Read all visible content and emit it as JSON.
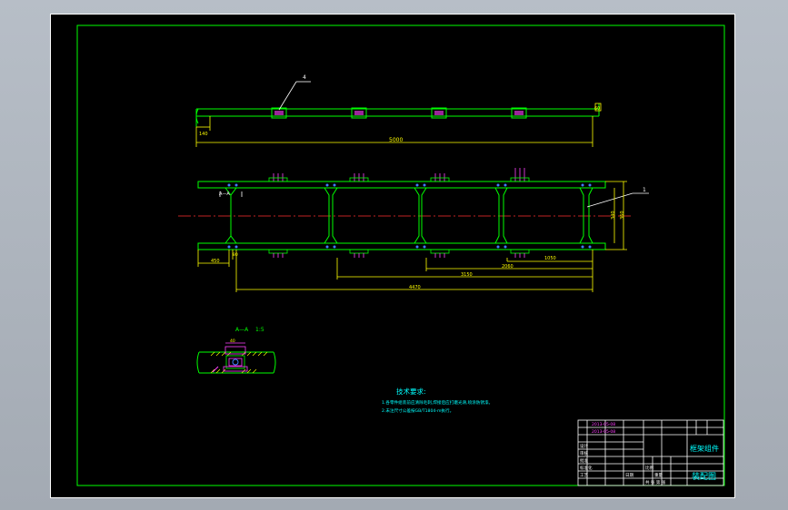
{
  "colors": {
    "frame": "#00ff00",
    "part": "#00ff00",
    "dim": "#ffff00",
    "center": "#ff3030",
    "bolt": "#ff40ff",
    "note": "#00ffff",
    "hatch": "#ffff00",
    "white": "#ffffff"
  },
  "top_view": {
    "balloon": "4",
    "dim_total": "5000",
    "dim_left": "140",
    "dim_right": "60"
  },
  "plan_view": {
    "balloon": "1",
    "section_marker": "A—A",
    "dim_right_inner": "340",
    "dim_right_outer": "360",
    "dim_left": "450",
    "dim_left_small": "80",
    "dim_a": "1050",
    "dim_b": "2060",
    "dim_c": "3150",
    "dim_total": "4470"
  },
  "section_view": {
    "title": "A—A",
    "scale": "1:5",
    "dim_top": "40"
  },
  "notes": {
    "heading": "技术要求:",
    "line1": "1.各零件组装前应清除毛刺,焊接后应打磨光滑,喷涂防锈漆。",
    "line2": "2.未注尺寸公差按GB/T1804-m执行。"
  },
  "title_block": {
    "stamp1": "2013-05-08",
    "stamp2": "2013-05-08",
    "label_design": "设计",
    "label_check": "审核",
    "label_approve": "批准",
    "label_standard": "标准化",
    "label_process": "工艺",
    "label_date": "日期",
    "label_scale": "比例",
    "label_weight": "重量",
    "label_sheet": "共 张 第 张",
    "drawing_name": "框架组件",
    "company": "装配图"
  }
}
